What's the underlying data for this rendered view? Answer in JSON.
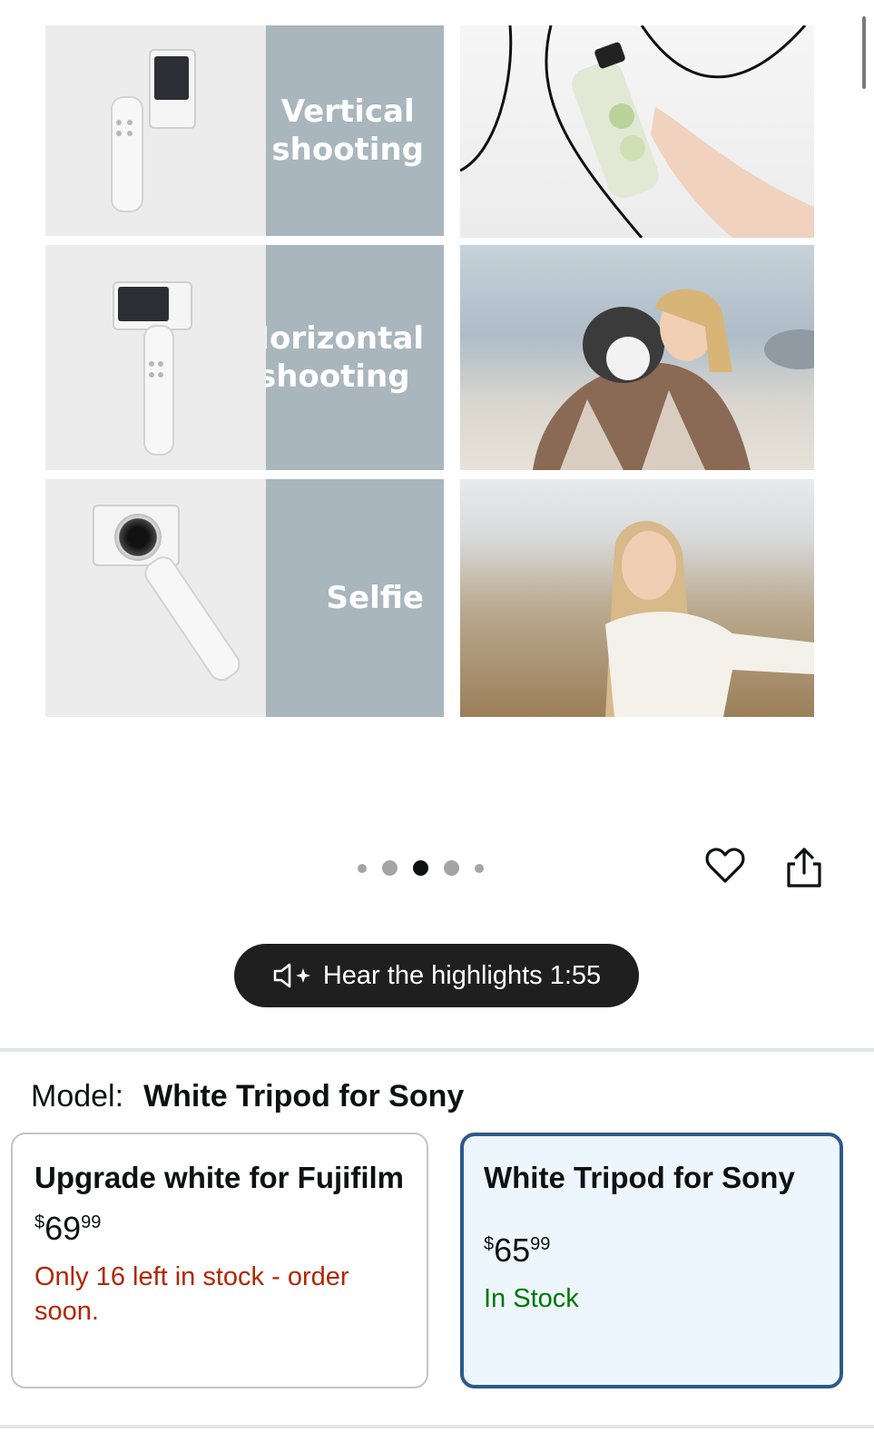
{
  "gallery": {
    "rows": [
      {
        "label": "Vertical\nshooting",
        "photo": "bottle-photo"
      },
      {
        "label": "Horizontal\nshooting",
        "photo": "woman-with-husky-photo"
      },
      {
        "label": "Selfie",
        "photo": "woman-selfie-photo"
      }
    ],
    "dots_total": 5,
    "active_dot_index": 2
  },
  "actions": {
    "favorite_icon": "heart-icon",
    "share_icon": "share-icon"
  },
  "highlights": {
    "label": "Hear the highlights 1:55",
    "icon": "speaker-sparkle-icon"
  },
  "model": {
    "label": "Model:",
    "selected": "White Tripod for Sony"
  },
  "options": [
    {
      "title": "Upgrade white for Fujifilm",
      "price_symbol": "$",
      "price_whole": "69",
      "price_cents": "99",
      "stock": "Only 16 left in stock - order soon.",
      "stock_color": "#b12704"
    },
    {
      "title": "White Tripod for Sony",
      "price_symbol": "$",
      "price_whole": "65",
      "price_cents": "99",
      "stock": "In Stock",
      "stock_color": "#007600",
      "selected": true
    }
  ],
  "colors": {
    "selected_border": "#2e5a8a",
    "selected_bg": "#edf6fc",
    "label_panel": "#a9b6bd"
  }
}
